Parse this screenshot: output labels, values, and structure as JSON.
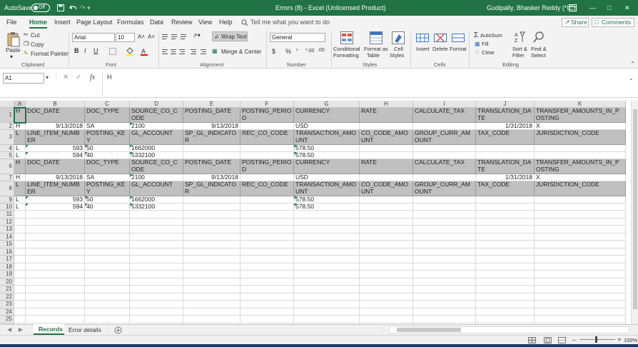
{
  "titlebar": {
    "autosave_label": "AutoSave",
    "autosave_state": "Off",
    "undo_icon": "undo-icon",
    "doc_title": "Errors (8)  -  Excel (Unlicensed Product)",
    "user_name": "Gudipally, Bhasker Reddy (*IC)"
  },
  "tabs": [
    "File",
    "Home",
    "Insert",
    "Page Layout",
    "Formulas",
    "Data",
    "Review",
    "View",
    "Help"
  ],
  "tell_me": "Tell me what you want to do",
  "share_label": "Share",
  "comments_label": "Comments",
  "ribbon": {
    "clipboard": {
      "paste": "Paste",
      "cut": "Cut",
      "copy": "Copy",
      "format_painter": "Format Painter",
      "group": "Clipboard"
    },
    "font": {
      "name": "Arial",
      "size": "10",
      "bold": "B",
      "italic": "I",
      "underline": "U",
      "grow": "A˄",
      "shrink": "A˅",
      "group": "Font"
    },
    "alignment": {
      "wrap": "Wrap Text",
      "merge": "Merge & Center",
      "group": "Alignment"
    },
    "number": {
      "format": "General",
      "currency": "$",
      "percent": "%",
      "comma": "’",
      "inc_dec": "⁰.00",
      "dec_dec": ".00",
      "group": "Number"
    },
    "styles": {
      "cond_line1": "Conditional",
      "cond_line2": "Formatting",
      "table_line1": "Format as",
      "table_line2": "Table",
      "cell_line1": "Cell",
      "cell_line2": "Styles",
      "group": "Styles"
    },
    "cells": {
      "insert": "Insert",
      "delete": "Delete",
      "format": "Format",
      "group": "Cells"
    },
    "editing": {
      "autosum": "AutoSum",
      "fill": "Fill",
      "clear": "Clear",
      "sort_line1": "Sort &",
      "sort_line2": "Filter",
      "find_line1": "Find &",
      "find_line2": "Select",
      "group": "Editing"
    }
  },
  "formula_bar": {
    "name_box": "A1",
    "fx": "fx",
    "content": "H"
  },
  "columns": [
    {
      "letter": "A",
      "w": 16
    },
    {
      "letter": "B",
      "w": 83
    },
    {
      "letter": "C",
      "w": 63
    },
    {
      "letter": "D",
      "w": 75
    },
    {
      "letter": "E",
      "w": 80
    },
    {
      "letter": "F",
      "w": 75
    },
    {
      "letter": "G",
      "w": 92
    },
    {
      "letter": "H",
      "w": 75
    },
    {
      "letter": "I",
      "w": 88
    },
    {
      "letter": "J",
      "w": 82
    },
    {
      "letter": "K",
      "w": 128
    }
  ],
  "rows": [
    {
      "n": "1",
      "h": 20,
      "shade": true,
      "cells": [
        "H",
        "DOC_DATE",
        "DOC_TYPE",
        "SOURCE_CO_CODE",
        "POSTING_DATE",
        "POSTING_PERIOD",
        "CURRENCY",
        "RATE",
        "CALCULATE_TAX",
        "TRANSLATION_DATE",
        "TRANSFER_AMOUNTS_IN_POSTING"
      ]
    },
    {
      "n": "2",
      "h": 9,
      "shade": false,
      "cells": [
        "H",
        "9/13/2018",
        "SA",
        "2100",
        "9/13/2018",
        "",
        "USD",
        "",
        "",
        "1/31/2018",
        "X"
      ]
    },
    {
      "n": "3",
      "h": 20,
      "shade": true,
      "cells": [
        "L",
        "LINE_ITEM_NUMBER",
        "POSTING_KEY",
        "GL_ACCOUNT",
        "SP_GL_INDICATOR",
        "REC_CO_CODE",
        "TRANSACTION_AMOUNT",
        "CO_CODE_AMOUNT",
        "GROUP_CURR_AMOUNT",
        "TAX_CODE",
        "JURISDICTION_CODE"
      ]
    },
    {
      "n": "4",
      "h": 9,
      "shade": false,
      "cells": [
        "L",
        "593",
        "50",
        "1662000",
        "",
        "",
        "578.50",
        "",
        "",
        "",
        ""
      ]
    },
    {
      "n": "5",
      "h": 9,
      "shade": false,
      "cells": [
        "L",
        "594",
        "40",
        "5332100",
        "",
        "",
        "578.50",
        "",
        "",
        "",
        ""
      ]
    },
    {
      "n": "6",
      "h": 20,
      "shade": true,
      "cells": [
        "H",
        "DOC_DATE",
        "DOC_TYPE",
        "SOURCE_CO_CODE",
        "POSTING_DATE",
        "POSTING_PERIOD",
        "CURRENCY",
        "RATE",
        "CALCULATE_TAX",
        "TRANSLATION_DATE",
        "TRANSFER_AMOUNTS_IN_POSTING"
      ]
    },
    {
      "n": "7",
      "h": 9,
      "shade": false,
      "cells": [
        "H",
        "9/13/2018",
        "SA",
        "2100",
        "9/13/2018",
        "",
        "USD",
        "",
        "",
        "1/31/2018",
        "X"
      ]
    },
    {
      "n": "8",
      "h": 20,
      "shade": true,
      "cells": [
        "L",
        "LINE_ITEM_NUMBER",
        "POSTING_KEY",
        "GL_ACCOUNT",
        "SP_GL_INDICATOR",
        "REC_CO_CODE",
        "TRANSACTION_AMOUNT",
        "CO_CODE_AMOUNT",
        "GROUP_CURR_AMOUNT",
        "TAX_CODE",
        "JURISDICTION_CODE"
      ]
    },
    {
      "n": "9",
      "h": 9,
      "shade": false,
      "cells": [
        "L",
        "593",
        "50",
        "1662000",
        "",
        "",
        "578.50",
        "",
        "",
        "",
        ""
      ]
    },
    {
      "n": "10",
      "h": 9,
      "shade": false,
      "cells": [
        "L",
        "594",
        "40",
        "5332100",
        "",
        "",
        "578.50",
        "",
        "",
        "",
        ""
      ]
    }
  ],
  "blank_rows": [
    "11",
    "12",
    "13",
    "14",
    "15",
    "16",
    "17",
    "18",
    "19",
    "20",
    "21",
    "22",
    "23",
    "24",
    "25",
    "26"
  ],
  "sheets": [
    {
      "name": "Records",
      "active": true
    },
    {
      "name": "Error details",
      "active": false
    }
  ],
  "status": {
    "zoom": "100%"
  }
}
